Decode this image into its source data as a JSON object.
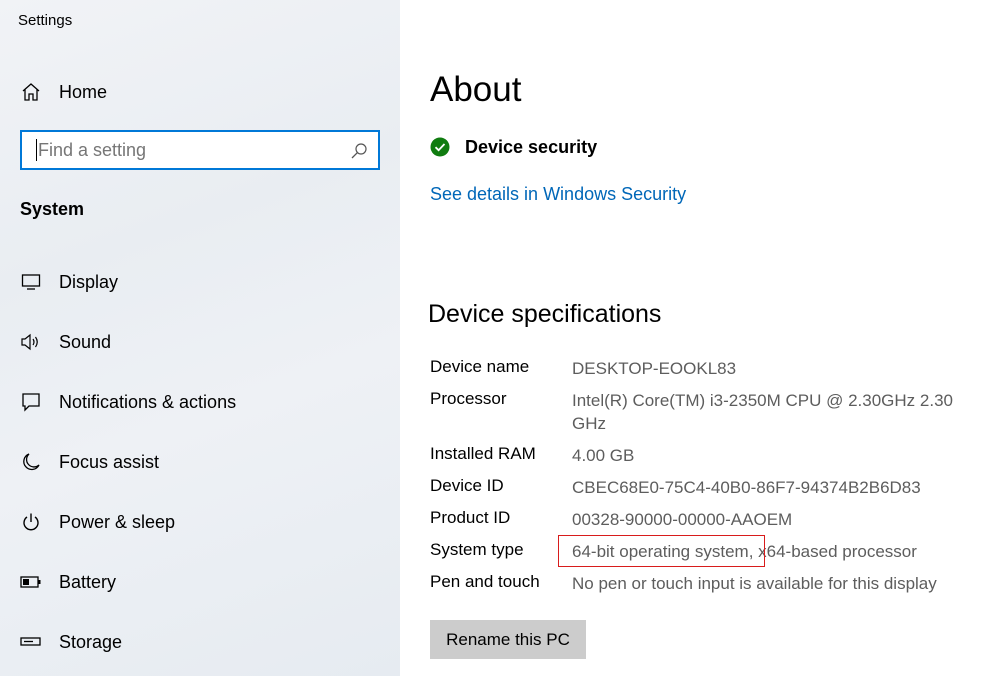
{
  "app": {
    "title": "Settings"
  },
  "sidebar": {
    "home_label": "Home",
    "search_placeholder": "Find a setting",
    "section_label": "System",
    "items": [
      {
        "label": "Display",
        "icon": "display-icon"
      },
      {
        "label": "Sound",
        "icon": "speaker-icon"
      },
      {
        "label": "Notifications & actions",
        "icon": "notification-icon"
      },
      {
        "label": "Focus assist",
        "icon": "moon-icon"
      },
      {
        "label": "Power & sleep",
        "icon": "power-icon"
      },
      {
        "label": "Battery",
        "icon": "battery-icon"
      },
      {
        "label": "Storage",
        "icon": "storage-icon"
      }
    ]
  },
  "main": {
    "title": "About",
    "security_label": "Device security",
    "security_link": "See details in Windows Security",
    "specs_title": "Device specifications",
    "specs": [
      {
        "key": "Device name",
        "value": "DESKTOP-EOOKL83"
      },
      {
        "key": "Processor",
        "value": "Intel(R) Core(TM) i3-2350M CPU @ 2.30GHz   2.30 GHz"
      },
      {
        "key": "Installed RAM",
        "value": "4.00 GB"
      },
      {
        "key": "Device ID",
        "value": "CBEC68E0-75C4-40B0-86F7-94374B2B6D83"
      },
      {
        "key": "Product ID",
        "value": "00328-90000-00000-AAOEM"
      },
      {
        "key": "System type",
        "value": "64-bit operating system, x64-based processor"
      },
      {
        "key": "Pen and touch",
        "value": "No pen or touch input is available for this display"
      }
    ],
    "rename_button": "Rename this PC"
  },
  "colors": {
    "accent": "#0078d7",
    "link": "#0067b8",
    "security_ok": "#107c10",
    "highlight": "#d81c1c"
  }
}
